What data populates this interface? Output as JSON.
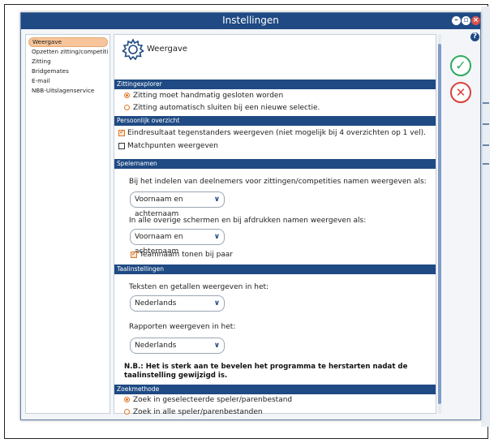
{
  "window": {
    "title": "Instellingen"
  },
  "sidebar": {
    "items": [
      {
        "label": "Weergave",
        "active": true
      },
      {
        "label": "Opzetten zitting/competitie"
      },
      {
        "label": "Zitting"
      },
      {
        "label": "Bridgemates"
      },
      {
        "label": "E-mail"
      },
      {
        "label": "NBB-Uitslagenservice"
      }
    ]
  },
  "page": {
    "title": "Weergave"
  },
  "sections": {
    "zittingexplorer": {
      "header": "Zittingexplorer",
      "options": [
        {
          "label": "Zitting moet handmatig gesloten worden",
          "selected": true
        },
        {
          "label": "Zitting automatisch sluiten bij een nieuwe selectie.",
          "selected": false
        }
      ]
    },
    "persoonlijk": {
      "header": "Persoonlijk overzicht",
      "checks": [
        {
          "label": "Eindresultaat tegenstanders weergeven (niet mogelijk bij 4 overzichten op 1 vel).",
          "checked": true
        },
        {
          "label": "Matchpunten weergeven",
          "checked": false
        }
      ]
    },
    "spelernamen": {
      "header": "Spelernamen",
      "text1": "Bij het indelen van deelnemers voor zittingen/competities namen weergeven als:",
      "select1": "Voornaam en achternaam",
      "text2": "In alle overige schermen en bij afdrukken namen weergeven als:",
      "select2": "Voornaam en achternaam",
      "check_label": "Teamnaam tonen bij paar",
      "check_checked": true
    },
    "taal": {
      "header": "Taalinstellingen",
      "text1": "Teksten en getallen weergeven in het:",
      "select1": "Nederlands",
      "text2": "Rapporten weergeven in het:",
      "select2": "Nederlands",
      "note": "N.B.: Het is sterk aan te bevelen het programma te herstarten nadat de taalinstelling gewijzigd is."
    },
    "zoek": {
      "header": "Zoekmethode",
      "options": [
        {
          "label": "Zoek in geselecteerde speler/parenbestand",
          "selected": true
        },
        {
          "label": "Zoek in alle speler/parenbestanden",
          "selected": false
        }
      ]
    }
  },
  "icons": {
    "settings": "gear-icon",
    "ok": "check-circle-icon",
    "cancel": "x-circle-icon",
    "help": "question-icon",
    "dropdown": "chevron-down-icon"
  },
  "colors": {
    "titlebar": "#1f4a83",
    "section_header": "#1f4a83",
    "accent": "#e17725",
    "active_nav": "#f7c59a",
    "ok": "#2eaa62",
    "cancel": "#d8413c"
  }
}
